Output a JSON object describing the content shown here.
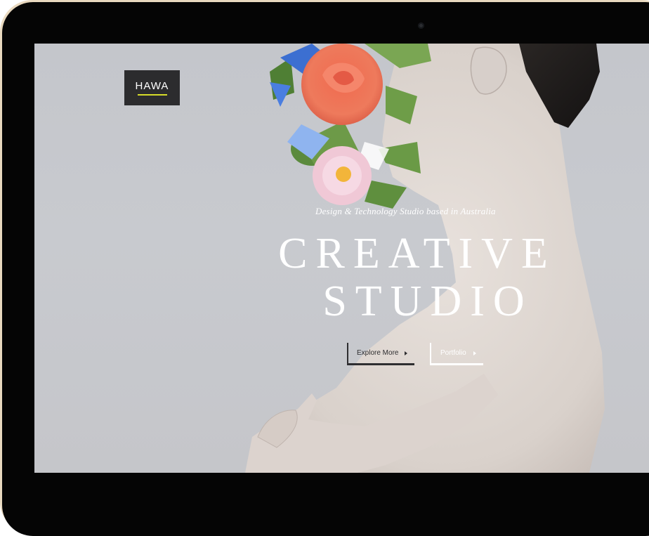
{
  "site": {
    "logo": "HAWA",
    "accent_color": "#d6dc2a"
  },
  "hero": {
    "tagline": "Design & Technology Studio based in Australia",
    "title_line_1": "CREATIVE",
    "title_line_2": "STUDIO"
  },
  "buttons": {
    "explore_label": "Explore More",
    "portfolio_label": "Portfolio"
  },
  "icons": {
    "explore_arrow": "triangle-right-icon",
    "portfolio_arrow": "triangle-right-icon"
  }
}
